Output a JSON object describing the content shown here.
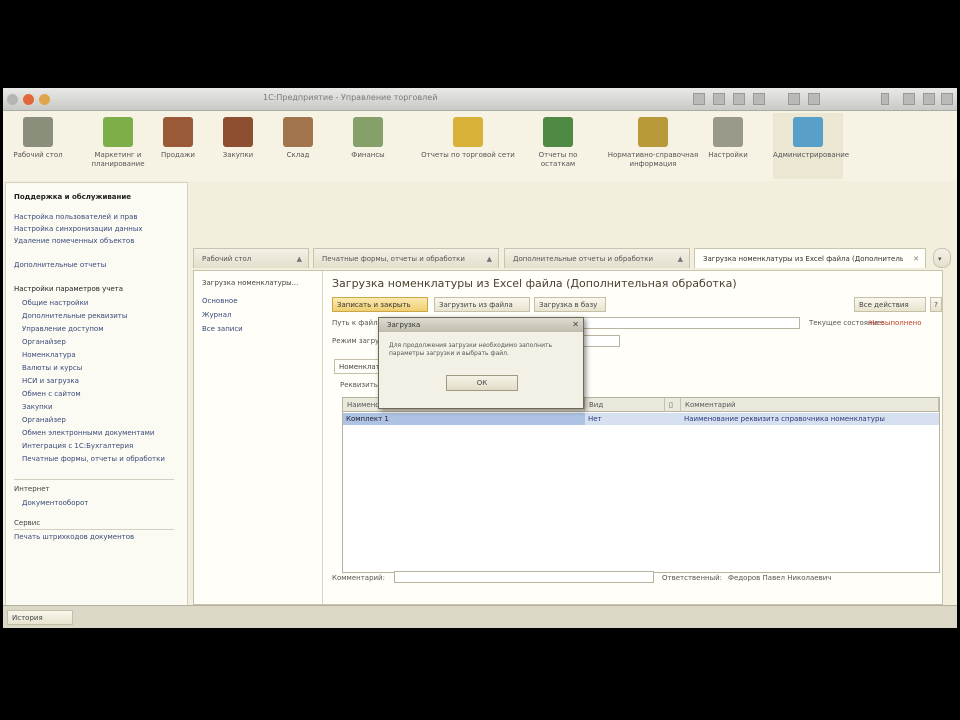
{
  "window": {
    "title": "1С:Предприятие - Управление торговлей"
  },
  "toolbar": {
    "items": [
      {
        "label": "Рабочий стол",
        "color": "#8a8f7c"
      },
      {
        "label": "Маркетинг и планирование",
        "color": "#7cae4a"
      },
      {
        "label": "Продажи",
        "color": "#9a5a38"
      },
      {
        "label": "Закупки",
        "color": "#8e4e30"
      },
      {
        "label": "Склад",
        "color": "#a2744c"
      },
      {
        "label": "Финансы",
        "color": "#86a06a"
      },
      {
        "label": "Отчеты по торговой сети",
        "color": "#d9b23a"
      },
      {
        "label": "Отчеты по остаткам",
        "color": "#4f8a45"
      },
      {
        "label": "Нормативно-справочная информация",
        "color": "#b89a3a"
      },
      {
        "label": "Настройки",
        "color": "#9a9a8a"
      },
      {
        "label": "Администрирование",
        "color": "#58a0c8"
      }
    ]
  },
  "left_panel": {
    "section1_title": "Поддержка и обслуживание",
    "group1": [
      "Настройка пользователей и прав",
      "Настройка синхронизации данных",
      "Удаление помеченных объектов"
    ],
    "single": "Дополнительные отчеты",
    "section2_title": "Настройки параметров учета",
    "sub_items": [
      "Общие настройки",
      "Дополнительные реквизиты",
      "Управление доступом",
      "Органайзер",
      "Номенклатура",
      "Валюты и курсы",
      "НСИ и загрузка",
      "Обмен с сайтом",
      "Закупки",
      "Органайзер",
      "Обмен электронными документами",
      "Интеграция с 1С:Бухгалтерия",
      "Печатные формы, отчеты и обработки"
    ],
    "section3_title": "Интернет",
    "section3_items": [
      "Документооборот"
    ],
    "section4_title": "Сервис",
    "section4_items": [
      "Печать штрихкодов документов"
    ]
  },
  "tabs": [
    {
      "label": "Рабочий стол"
    },
    {
      "label": "Печатные формы, отчеты и обработки"
    },
    {
      "label": "Дополнительные отчеты и обработки"
    },
    {
      "label": "Загрузка номенклатуры из Excel файла (Дополнительная обработка)"
    }
  ],
  "content": {
    "nav_title": "Загрузка номенклатуры...",
    "nav_items": [
      "Основное",
      "Журнал",
      "Все записи"
    ],
    "title": "Загрузка номенклатуры из Excel файла (Дополнительная обработка)",
    "btn_write_close": "Записать и закрыть",
    "btn_choose_file": "Загрузить из файла",
    "btn_check": "Загрузка в базу",
    "btn_more": "Все действия",
    "label_file": "Путь к файлу:",
    "label_mode": "Режим загрузки:",
    "label_state": "Текущее состояние:",
    "state_value": "Не выполнено",
    "grid_tab": "Номенклатура",
    "grid_label": "Реквизиты для загрузки:",
    "grid_headers": [
      "Наименование",
      "Вид",
      "Реквизит",
      "Комментарий"
    ],
    "grid_row": [
      "Комплект 1",
      "Нет",
      "",
      "Наименование реквизита справочника номенклатуры"
    ],
    "footer_label": "Комментарий:",
    "footer_right_label": "Ответственный:",
    "footer_right_value": "Федоров Павел Николаевич"
  },
  "dialog": {
    "title": "Загрузка",
    "message": "Для продолжения загрузки необходимо заполнить параметры загрузки и выбрать файл.",
    "ok": "ОК"
  },
  "status": {
    "left_button": "История"
  }
}
